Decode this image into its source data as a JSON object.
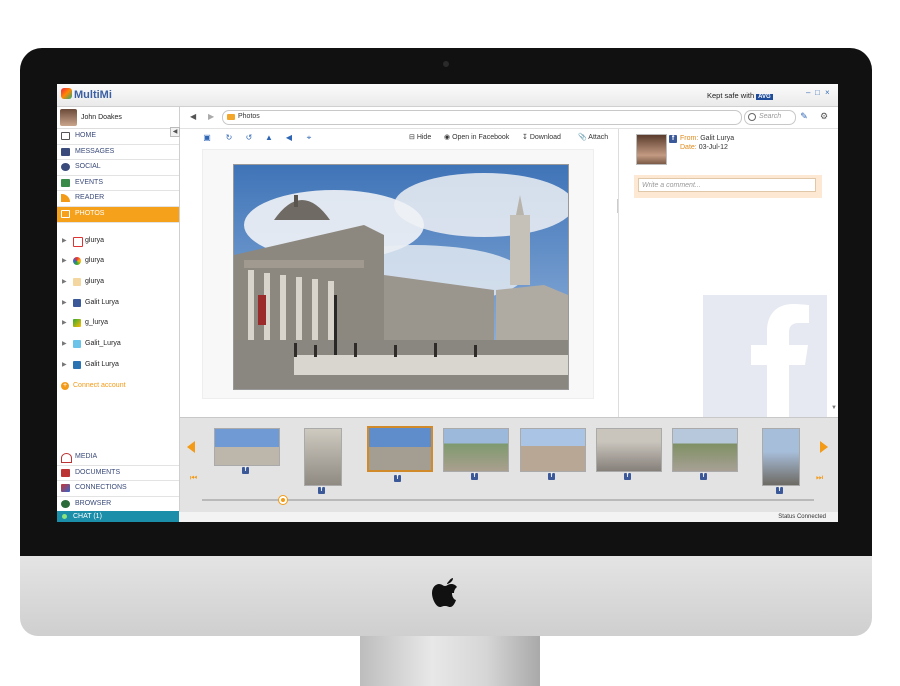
{
  "app": {
    "name": "MultiMi",
    "kept_safe": "Kept safe with",
    "avg": "AVG"
  },
  "user": {
    "name": "John Doakes"
  },
  "nav": [
    "HOME",
    "MESSAGES",
    "SOCIAL",
    "EVENTS",
    "READER",
    "PHOTOS"
  ],
  "accounts": [
    "glurya",
    "glurya",
    "glurya",
    "Galit Lurya",
    "g_lurya",
    "Galit_Lurya",
    "Galit Lurya"
  ],
  "connect_account": "Connect account",
  "bottom_nav": [
    "MEDIA",
    "DOCUMENTS",
    "CONNECTIONS",
    "BROWSER"
  ],
  "chat": "CHAT (1)",
  "status": "Status Connected",
  "path": "Photos",
  "search_placeholder": "Search",
  "photo_actions": {
    "hide": "Hide",
    "open_fb": "Open in Facebook",
    "download": "Download",
    "attach": "Attach"
  },
  "info": {
    "from_label": "From:",
    "from_value": "Galit Lurya",
    "date_label": "Date:",
    "date_value": "03-Jul-12",
    "comment_placeholder": "Write a comment...",
    "fb_letter": "f"
  },
  "colors": {
    "accent": "#f39a16",
    "facebook": "#3b5998",
    "chat": "#1b8faa",
    "nav_text": "#3a4a7a"
  },
  "icons": [
    "save-icon",
    "rotate-right-icon",
    "rotate-left-icon",
    "flip-vertical-icon",
    "flip-horizontal-icon",
    "crop-icon",
    "compose-icon",
    "settings-icon"
  ],
  "filmstrip": {
    "selected_index": 2,
    "slider_position": 0.13
  }
}
